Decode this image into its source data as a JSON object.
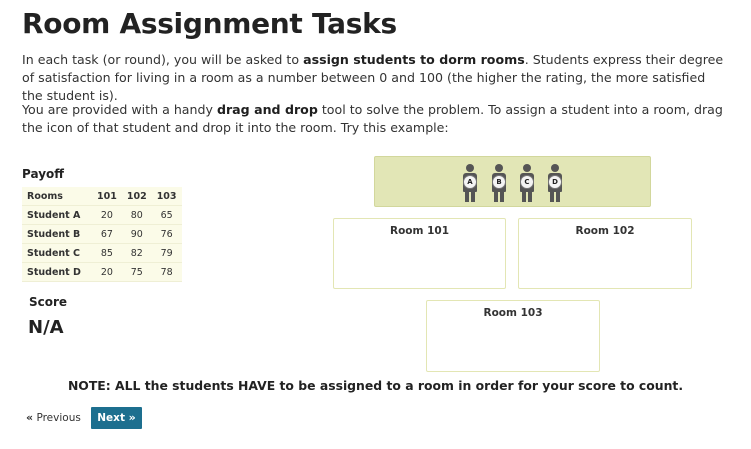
{
  "page": {
    "title": "Room Assignment Tasks",
    "para1": {
      "pre": "In each task (or round), you will be asked to ",
      "bold": "assign students to dorm rooms",
      "post": ". Students express their degree of satisfaction for living in a room as a number between 0 and 100 (the higher the rating, the more satisfied the student is)."
    },
    "para2": {
      "pre": "You are provided with a handy ",
      "bold": "drag and drop",
      "post": " tool to solve the problem. To assign a student into a room, drag the icon of that student and drop it into the room. Try this example:"
    }
  },
  "payoff": {
    "title": "Payoff",
    "header": [
      "Rooms",
      "101",
      "102",
      "103"
    ],
    "rows": [
      {
        "label": "Student A",
        "values": [
          "20",
          "80",
          "65"
        ]
      },
      {
        "label": "Student B",
        "values": [
          "67",
          "90",
          "76"
        ]
      },
      {
        "label": "Student C",
        "values": [
          "85",
          "82",
          "79"
        ]
      },
      {
        "label": "Student D",
        "values": [
          "20",
          "75",
          "78"
        ]
      }
    ]
  },
  "score": {
    "label": "Score",
    "value": "N/A"
  },
  "students": [
    "A",
    "B",
    "C",
    "D"
  ],
  "rooms": [
    "Room 101",
    "Room 102",
    "Room 103"
  ],
  "note": "NOTE: ALL the students HAVE to be assigned to a room in order for your score to count.",
  "nav": {
    "prev_icon": "«",
    "prev_label": "Previous",
    "next_label": "Next",
    "next_icon": "»",
    "next_color": "#1d6f8f"
  }
}
